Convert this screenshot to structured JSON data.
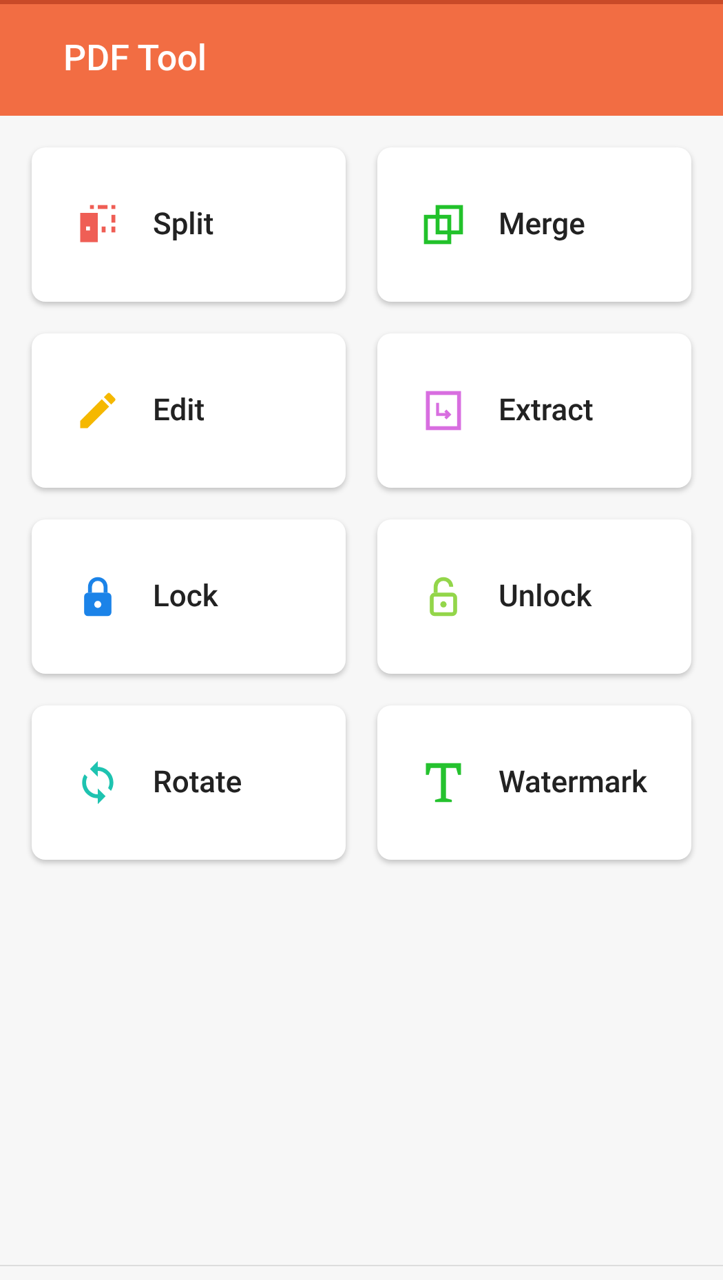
{
  "app_bar": {
    "title": "PDF Tool"
  },
  "tools": [
    {
      "label": "Split",
      "kind": "split",
      "color": "#ef5e55"
    },
    {
      "label": "Merge",
      "kind": "merge",
      "color": "#22c22b"
    },
    {
      "label": "Edit",
      "kind": "edit",
      "color": "#f5b800"
    },
    {
      "label": "Extract",
      "kind": "extract",
      "color": "#d86ee0"
    },
    {
      "label": "Lock",
      "kind": "lock",
      "color": "#1b83e8"
    },
    {
      "label": "Unlock",
      "kind": "unlock",
      "color": "#93d64a"
    },
    {
      "label": "Rotate",
      "kind": "rotate",
      "color": "#1ec3b0"
    },
    {
      "label": "Watermark",
      "kind": "watermark",
      "color": "#25c22e"
    }
  ]
}
